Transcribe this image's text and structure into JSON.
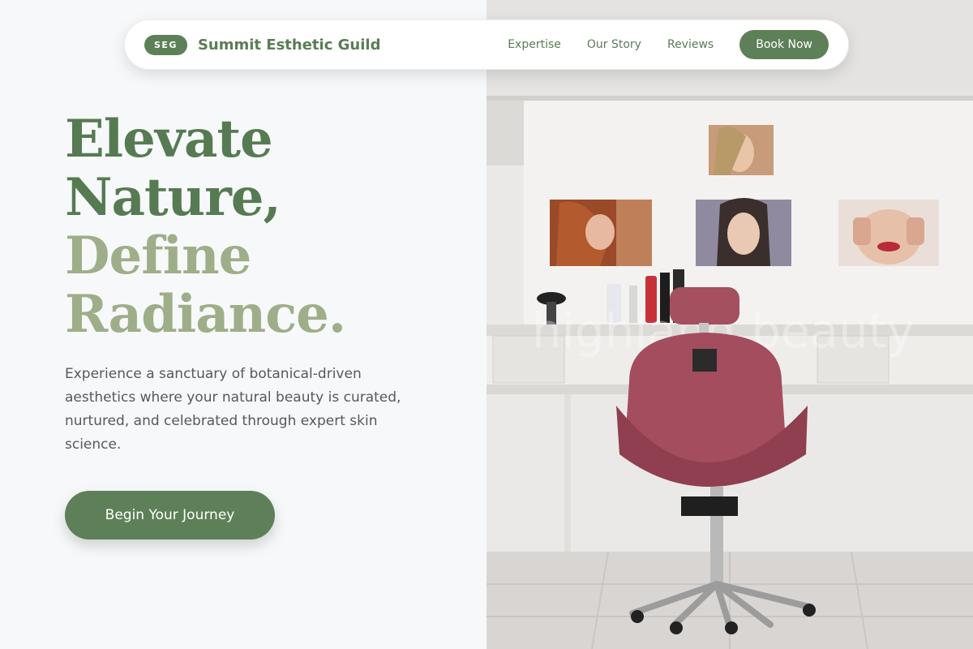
{
  "nav": {
    "badge": "SEG",
    "brand": "Summit Esthetic Guild",
    "links": [
      "Expertise",
      "Our Story",
      "Reviews"
    ],
    "cta": "Book Now"
  },
  "hero": {
    "line1": "Elevate",
    "line2": "Nature,",
    "line3": "Define",
    "line4": "Radiance.",
    "lead": "Experience a sanctuary of botanical-driven aesthetics where your natural beauty is curated, nurtured, and celebrated through expert skin science.",
    "cta": "Begin Your Journey"
  },
  "image": {
    "watermark": "highland.beauty"
  },
  "colors": {
    "accent": "#5e8058",
    "heading_dark": "#567b52",
    "heading_light": "#9eae88"
  }
}
